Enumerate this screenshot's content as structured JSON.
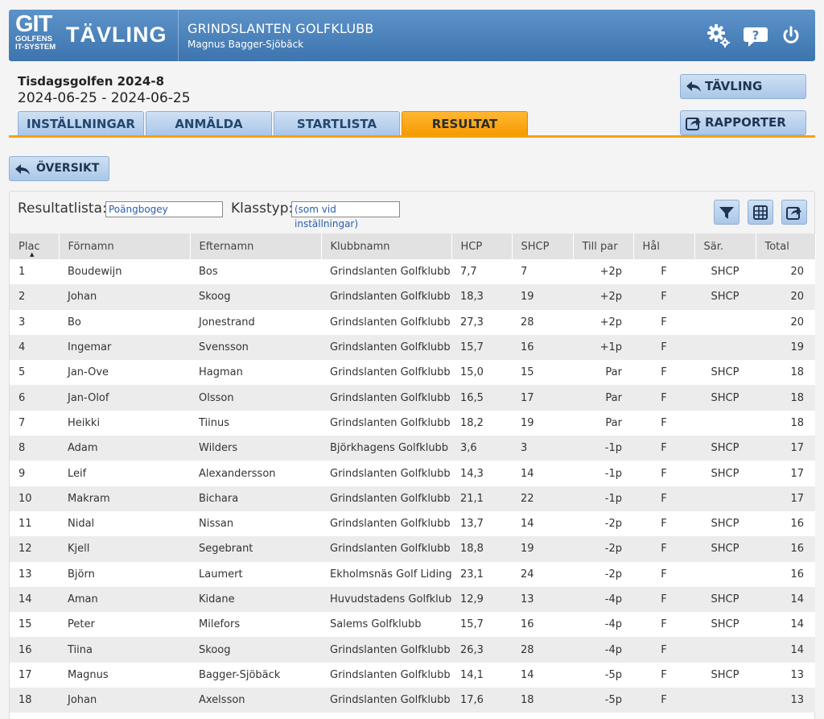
{
  "header": {
    "logo_main": "GIT",
    "logo_line1": "GOLFENS",
    "logo_line2": "IT-SYSTEM",
    "brand": "TÄVLING",
    "club": "GRINDSLANTEN GOLFKLUBB",
    "user": "Magnus Bagger-Sjöbäck",
    "icons": [
      "gear-icon",
      "help-icon",
      "power-icon"
    ]
  },
  "competition": {
    "name": "Tisdagsgolfen 2024-8",
    "dates": "2024-06-25 - 2024-06-25"
  },
  "tabs": [
    {
      "label": "INSTÄLLNINGAR",
      "active": false
    },
    {
      "label": "ANMÄLDA",
      "active": false
    },
    {
      "label": "STARTLISTA",
      "active": false
    },
    {
      "label": "RESULTAT",
      "active": true
    }
  ],
  "actions": {
    "tavling": "TÄVLING",
    "rapporter": "RAPPORTER",
    "oversikt": "ÖVERSIKT"
  },
  "filters": {
    "resultatlista_label": "Resultatlista:",
    "resultatlista_value": "Poängbogey",
    "klasstyp_label": "Klasstyp:",
    "klasstyp_value": "(som vid inställningar)"
  },
  "toolbar_icons": [
    "filter-icon",
    "table-icon",
    "export-icon"
  ],
  "colors": {
    "header_blue": "#4a83bd",
    "accent_orange": "#f5a300",
    "button_blue": "#bcd4ee"
  },
  "table": {
    "columns": [
      "Plac",
      "Förnamn",
      "Efternamn",
      "Klubbnamn",
      "HCP",
      "SHCP",
      "Till par",
      "Hål",
      "Sär.",
      "Total"
    ],
    "rows": [
      [
        "1",
        "Boudewijn",
        "Bos",
        "Grindslanten Golfklubb",
        "7,7",
        "7",
        "+2p",
        "F",
        "SHCP",
        "20"
      ],
      [
        "2",
        "Johan",
        "Skoog",
        "Grindslanten Golfklubb",
        "18,3",
        "19",
        "+2p",
        "F",
        "SHCP",
        "20"
      ],
      [
        "3",
        "Bo",
        "Jonestrand",
        "Grindslanten Golfklubb",
        "27,3",
        "28",
        "+2p",
        "F",
        "",
        "20"
      ],
      [
        "4",
        "Ingemar",
        "Svensson",
        "Grindslanten Golfklubb",
        "15,7",
        "16",
        "+1p",
        "F",
        "",
        "19"
      ],
      [
        "5",
        "Jan-Ove",
        "Hagman",
        "Grindslanten Golfklubb",
        "15,0",
        "15",
        "Par",
        "F",
        "SHCP",
        "18"
      ],
      [
        "6",
        "Jan-Olof",
        "Olsson",
        "Grindslanten Golfklubb",
        "16,5",
        "17",
        "Par",
        "F",
        "SHCP",
        "18"
      ],
      [
        "7",
        "Heikki",
        "Tiinus",
        "Grindslanten Golfklubb",
        "18,2",
        "19",
        "Par",
        "F",
        "",
        "18"
      ],
      [
        "8",
        "Adam",
        "Wilders",
        "Björkhagens Golfklubb",
        "3,6",
        "3",
        "-1p",
        "F",
        "SHCP",
        "17"
      ],
      [
        "9",
        "Leif",
        "Alexandersson",
        "Grindslanten Golfklubb",
        "14,3",
        "14",
        "-1p",
        "F",
        "SHCP",
        "17"
      ],
      [
        "10",
        "Makram",
        "Bichara",
        "Grindslanten Golfklubb",
        "21,1",
        "22",
        "-1p",
        "F",
        "",
        "17"
      ],
      [
        "11",
        "Nidal",
        "Nissan",
        "Grindslanten Golfklubb",
        "13,7",
        "14",
        "-2p",
        "F",
        "SHCP",
        "16"
      ],
      [
        "12",
        "Kjell",
        "Segebrant",
        "Grindslanten Golfklubb",
        "18,8",
        "19",
        "-2p",
        "F",
        "SHCP",
        "16"
      ],
      [
        "13",
        "Björn",
        "Laumert",
        "Ekholmsnäs Golf Lidingö",
        "23,1",
        "24",
        "-2p",
        "F",
        "",
        "16"
      ],
      [
        "14",
        "Aman",
        "Kidane",
        "Huvudstadens Golfklubb",
        "12,9",
        "13",
        "-4p",
        "F",
        "SHCP",
        "14"
      ],
      [
        "15",
        "Peter",
        "Milefors",
        "Salems Golfklubb",
        "15,7",
        "16",
        "-4p",
        "F",
        "SHCP",
        "14"
      ],
      [
        "16",
        "Tiina",
        "Skoog",
        "Grindslanten Golfklubb",
        "26,3",
        "28",
        "-4p",
        "F",
        "",
        "14"
      ],
      [
        "17",
        "Magnus",
        "Bagger-Sjöbäck",
        "Grindslanten Golfklubb",
        "14,1",
        "14",
        "-5p",
        "F",
        "SHCP",
        "13"
      ],
      [
        "18",
        "Johan",
        "Axelsson",
        "Grindslanten Golfklubb",
        "17,6",
        "18",
        "-5p",
        "F",
        "",
        "13"
      ]
    ]
  }
}
